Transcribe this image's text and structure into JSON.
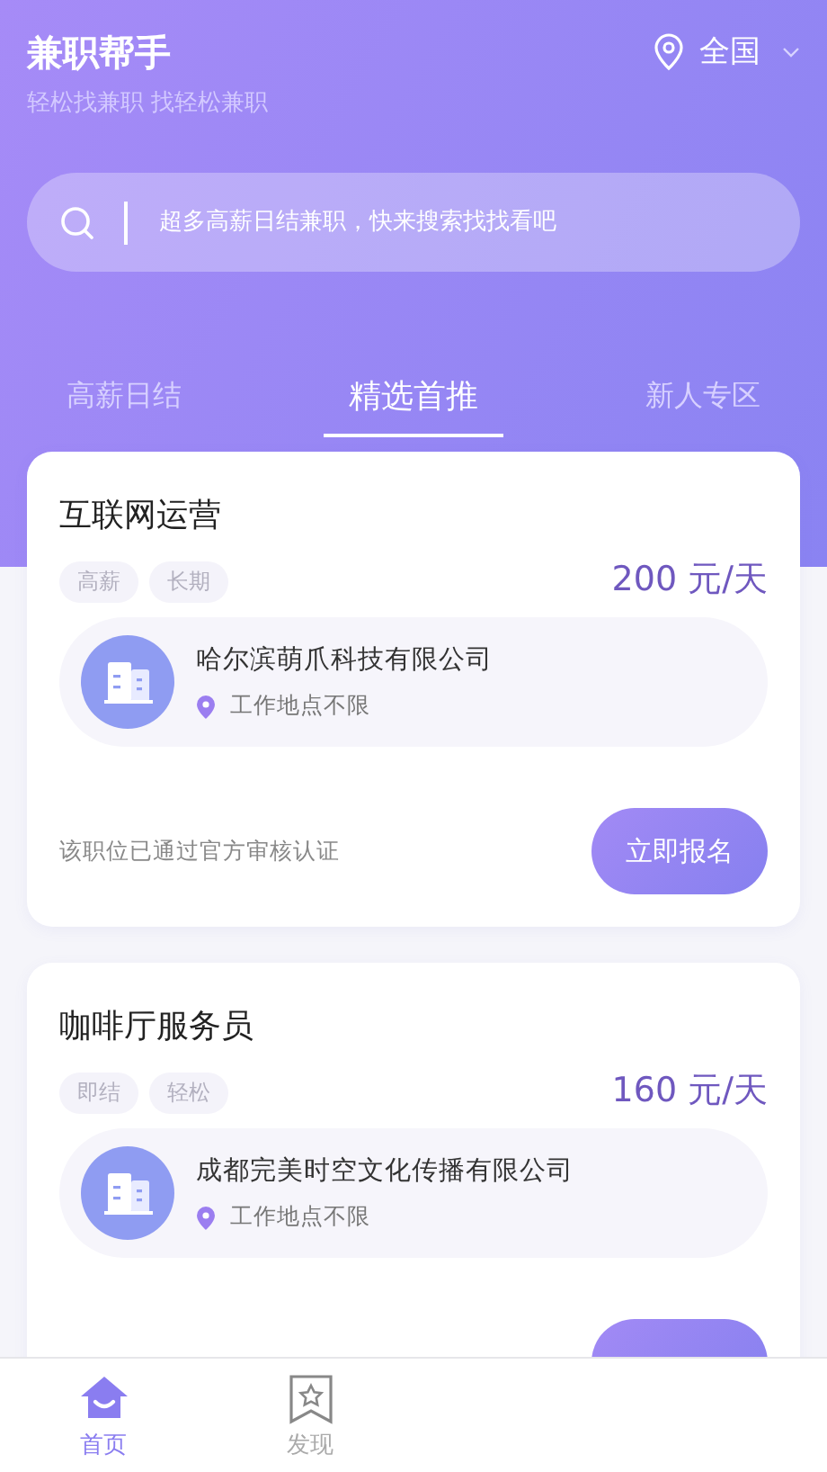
{
  "header": {
    "title": "兼职帮手",
    "subtitle": "轻松找兼职 找轻松兼职",
    "location": "全国"
  },
  "search": {
    "placeholder": "超多高薪日结兼职，快来搜索找找看吧"
  },
  "tabs": [
    {
      "label": "高薪日结",
      "selected": false
    },
    {
      "label": "精选首推",
      "selected": true
    },
    {
      "label": "新人专区",
      "selected": false
    }
  ],
  "jobs": [
    {
      "title": "互联网运营",
      "tags": [
        "高薪",
        "长期"
      ],
      "pay": "200 元/天",
      "company": "哈尔滨萌爪科技有限公司",
      "location": "工作地点不限",
      "note": "该职位已通过官方审核认证",
      "button": "立即报名"
    },
    {
      "title": "咖啡厅服务员",
      "tags": [
        "即结",
        "轻松"
      ],
      "pay": "160 元/天",
      "company": "成都完美时空文化传播有限公司",
      "location": "工作地点不限"
    }
  ],
  "bottom_nav": [
    {
      "label": "首页",
      "kind": "home",
      "selected": true
    },
    {
      "label": "发现",
      "kind": "discover",
      "selected": false
    }
  ]
}
